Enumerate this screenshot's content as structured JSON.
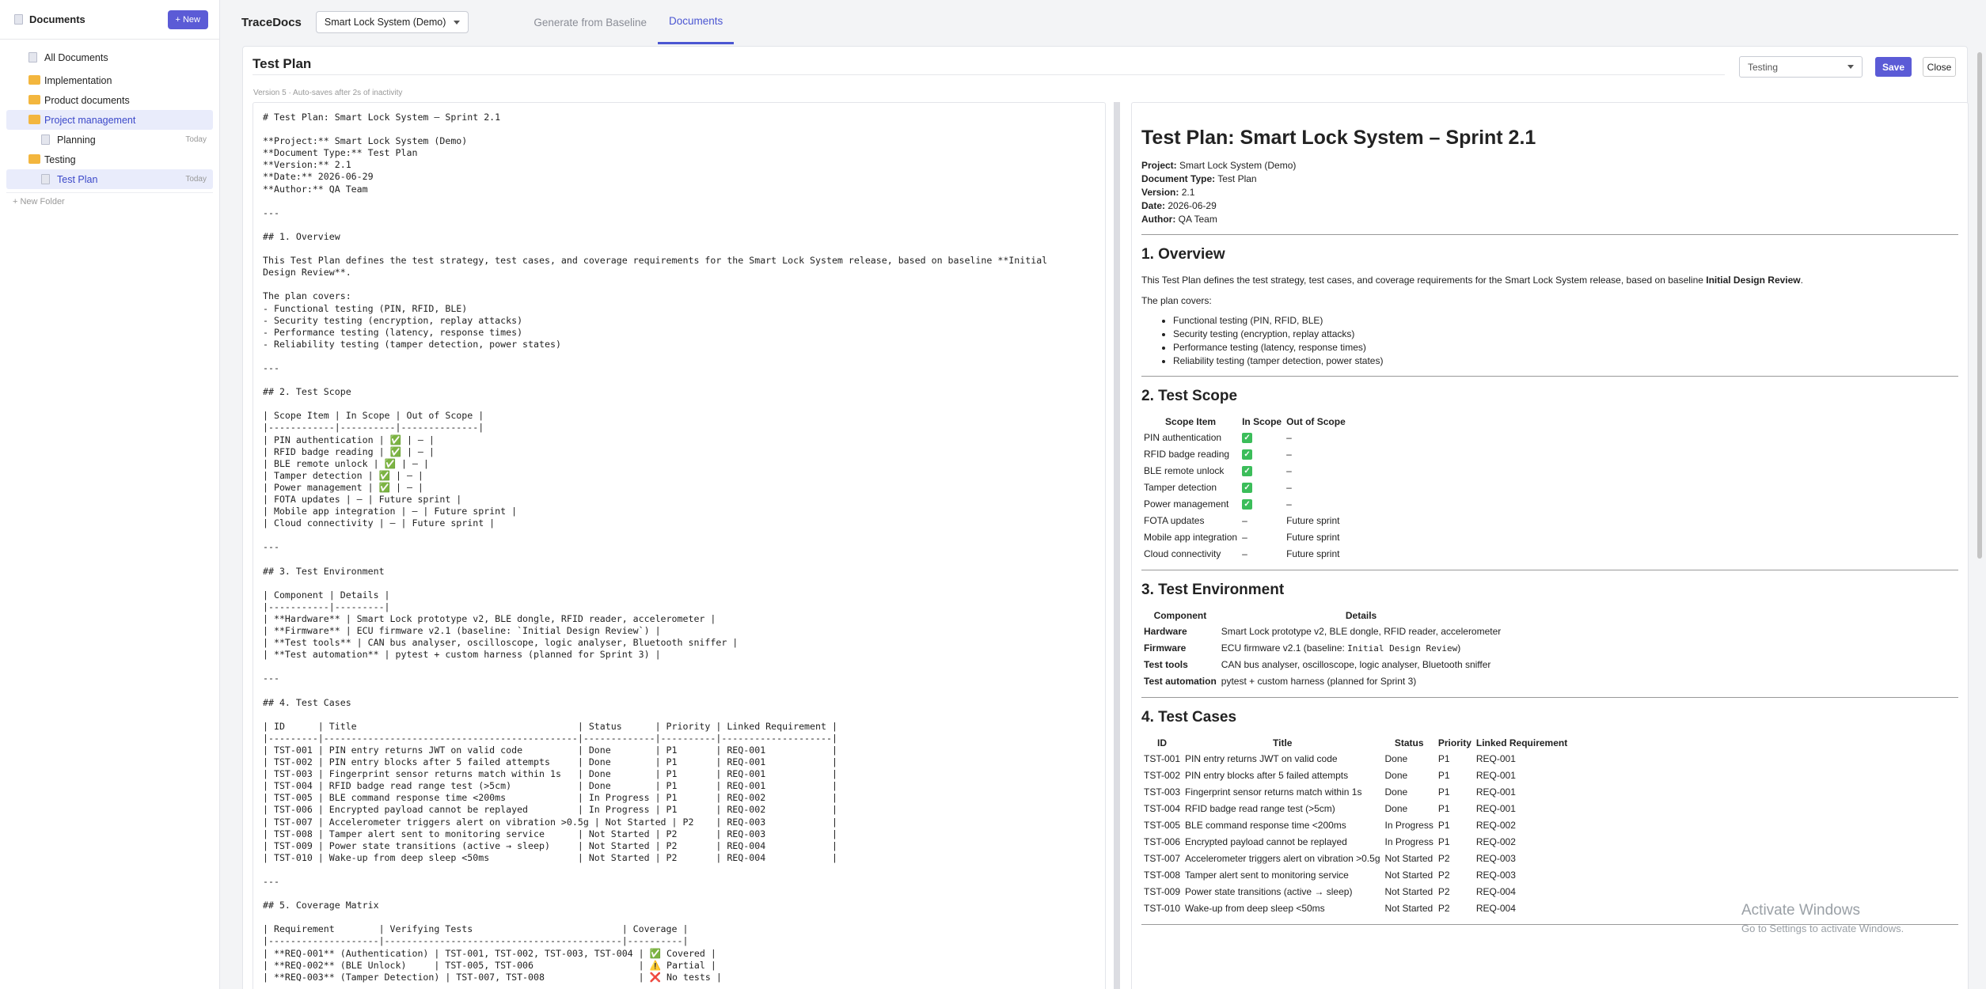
{
  "sidebar": {
    "title": "Documents",
    "new_label": "+ New",
    "items": [
      {
        "label": "All Documents",
        "date": "",
        "icon": "doc-icon"
      },
      {
        "label": "Implementation",
        "date": "",
        "icon": "folder-icon"
      },
      {
        "label": "Product documents",
        "date": "",
        "icon": "folder-icon"
      },
      {
        "label": "Project management",
        "date": "",
        "icon": "folder-icon"
      },
      {
        "label": "Planning",
        "date": "Today",
        "icon": "doc-icon"
      },
      {
        "label": "Testing",
        "date": "",
        "icon": "folder-icon"
      },
      {
        "label": "Test Plan",
        "date": "Today",
        "icon": "doc-icon"
      }
    ],
    "new_folder_label": "+ New Folder"
  },
  "header": {
    "brand": "TraceDocs",
    "project": "Smart Lock System (Demo)",
    "tabs": [
      "Generate from Baseline",
      "Documents"
    ]
  },
  "editor": {
    "title": "Test Plan",
    "status": "Testing",
    "save_label": "Save",
    "close_label": "Close",
    "autosave_note": "Version 5 · Auto-saves after 2s of inactivity",
    "markdown": "# Test Plan: Smart Lock System – Sprint 2.1\n\n**Project:** Smart Lock System (Demo)\n**Document Type:** Test Plan\n**Version:** 2.1\n**Date:** 2026-06-29\n**Author:** QA Team\n\n---\n\n## 1. Overview\n\nThis Test Plan defines the test strategy, test cases, and coverage requirements for the Smart Lock System release, based on baseline **Initial\nDesign Review**.\n\nThe plan covers:\n- Functional testing (PIN, RFID, BLE)\n- Security testing (encryption, replay attacks)\n- Performance testing (latency, response times)\n- Reliability testing (tamper detection, power states)\n\n---\n\n## 2. Test Scope\n\n| Scope Item | In Scope | Out of Scope |\n|------------|----------|--------------|\n| PIN authentication | ✅ | – |\n| RFID badge reading | ✅ | – |\n| BLE remote unlock | ✅ | – |\n| Tamper detection | ✅ | – |\n| Power management | ✅ | – |\n| FOTA updates | – | Future sprint |\n| Mobile app integration | – | Future sprint |\n| Cloud connectivity | – | Future sprint |\n\n---\n\n## 3. Test Environment\n\n| Component | Details |\n|-----------|---------|\n| **Hardware** | Smart Lock prototype v2, BLE dongle, RFID reader, accelerometer |\n| **Firmware** | ECU firmware v2.1 (baseline: `Initial Design Review`) |\n| **Test tools** | CAN bus analyser, oscilloscope, logic analyser, Bluetooth sniffer |\n| **Test automation** | pytest + custom harness (planned for Sprint 3) |\n\n---\n\n## 4. Test Cases\n\n| ID      | Title                                        | Status      | Priority | Linked Requirement |\n|---------|----------------------------------------------|-------------|----------|--------------------|\n| TST-001 | PIN entry returns JWT on valid code          | Done        | P1       | REQ-001            |\n| TST-002 | PIN entry blocks after 5 failed attempts     | Done        | P1       | REQ-001            |\n| TST-003 | Fingerprint sensor returns match within 1s   | Done        | P1       | REQ-001            |\n| TST-004 | RFID badge read range test (>5cm)            | Done        | P1       | REQ-001            |\n| TST-005 | BLE command response time <200ms             | In Progress | P1       | REQ-002            |\n| TST-006 | Encrypted payload cannot be replayed         | In Progress | P1       | REQ-002            |\n| TST-007 | Accelerometer triggers alert on vibration >0.5g | Not Started | P2    | REQ-003            |\n| TST-008 | Tamper alert sent to monitoring service      | Not Started | P2       | REQ-003            |\n| TST-009 | Power state transitions (active → sleep)     | Not Started | P2       | REQ-004            |\n| TST-010 | Wake-up from deep sleep <50ms                | Not Started | P2       | REQ-004            |\n\n---\n\n## 5. Coverage Matrix\n\n| Requirement        | Verifying Tests                           | Coverage |\n|--------------------|-------------------------------------------|----------|\n| **REQ-001** (Authentication) | TST-001, TST-002, TST-003, TST-004 | ✅ Covered |\n| **REQ-002** (BLE Unlock)     | TST-005, TST-006                   | ⚠️ Partial |\n| **REQ-003** (Tamper Detection) | TST-007, TST-008                 | ❌ No tests |"
  },
  "preview": {
    "h1": "Test Plan: Smart Lock System – Sprint 2.1",
    "meta": [
      {
        "k": "Project:",
        "v": "Smart Lock System (Demo)"
      },
      {
        "k": "Document Type:",
        "v": "Test Plan"
      },
      {
        "k": "Version:",
        "v": "2.1"
      },
      {
        "k": "Date:",
        "v": "2026-06-29"
      },
      {
        "k": "Author:",
        "v": "QA Team"
      }
    ],
    "s1": {
      "title": "1. Overview",
      "p1": "This Test Plan defines the test strategy, test cases, and coverage requirements for the Smart Lock System release, based on baseline ",
      "p1_bold": "Initial Design Review",
      "p1_end": ".",
      "p2": "The plan covers:",
      "bullets": [
        "Functional testing (PIN, RFID, BLE)",
        "Security testing (encryption, replay attacks)",
        "Performance testing (latency, response times)",
        "Reliability testing (tamper detection, power states)"
      ]
    },
    "s2": {
      "title": "2. Test Scope",
      "headers": [
        "Scope Item",
        "In Scope",
        "Out of Scope"
      ],
      "rows": [
        [
          "PIN authentication",
          "✅",
          "–"
        ],
        [
          "RFID badge reading",
          "✅",
          "–"
        ],
        [
          "BLE remote unlock",
          "✅",
          "–"
        ],
        [
          "Tamper detection",
          "✅",
          "–"
        ],
        [
          "Power management",
          "✅",
          "–"
        ],
        [
          "FOTA updates",
          "–",
          "Future sprint"
        ],
        [
          "Mobile app integration",
          "–",
          "Future sprint"
        ],
        [
          "Cloud connectivity",
          "–",
          "Future sprint"
        ]
      ]
    },
    "s3": {
      "title": "3. Test Environment",
      "headers": [
        "Component",
        "Details"
      ],
      "rows": [
        [
          "Hardware",
          "Smart Lock prototype v2, BLE dongle, RFID reader, accelerometer",
          ""
        ],
        [
          "Firmware",
          "ECU firmware v2.1 (baseline: ",
          "Initial Design Review",
          ")"
        ],
        [
          "Test tools",
          "CAN bus analyser, oscilloscope, logic analyser, Bluetooth sniffer",
          ""
        ],
        [
          "Test automation",
          "pytest + custom harness (planned for Sprint 3)",
          ""
        ]
      ]
    },
    "s4": {
      "title": "4. Test Cases",
      "headers": [
        "ID",
        "Title",
        "Status",
        "Priority",
        "Linked Requirement"
      ],
      "rows": [
        [
          "TST-001",
          "PIN entry returns JWT on valid code",
          "Done",
          "P1",
          "REQ-001"
        ],
        [
          "TST-002",
          "PIN entry blocks after 5 failed attempts",
          "Done",
          "P1",
          "REQ-001"
        ],
        [
          "TST-003",
          "Fingerprint sensor returns match within 1s",
          "Done",
          "P1",
          "REQ-001"
        ],
        [
          "TST-004",
          "RFID badge read range test (>5cm)",
          "Done",
          "P1",
          "REQ-001"
        ],
        [
          "TST-005",
          "BLE command response time <200ms",
          "In Progress",
          "P1",
          "REQ-002"
        ],
        [
          "TST-006",
          "Encrypted payload cannot be replayed",
          "In Progress",
          "P1",
          "REQ-002"
        ],
        [
          "TST-007",
          "Accelerometer triggers alert on vibration >0.5g",
          "Not Started",
          "P2",
          "REQ-003"
        ],
        [
          "TST-008",
          "Tamper alert sent to monitoring service",
          "Not Started",
          "P2",
          "REQ-003"
        ],
        [
          "TST-009",
          "Power state transitions (active → sleep)",
          "Not Started",
          "P2",
          "REQ-004"
        ],
        [
          "TST-010",
          "Wake-up from deep sleep <50ms",
          "Not Started",
          "P2",
          "REQ-004"
        ]
      ]
    }
  },
  "watermark": {
    "line1": "Activate Windows",
    "line2": "Go to Settings to activate Windows."
  },
  "colors": {
    "accent": "#5b5bd6",
    "folder": "#f3b63e",
    "check": "#3bbd5a"
  }
}
